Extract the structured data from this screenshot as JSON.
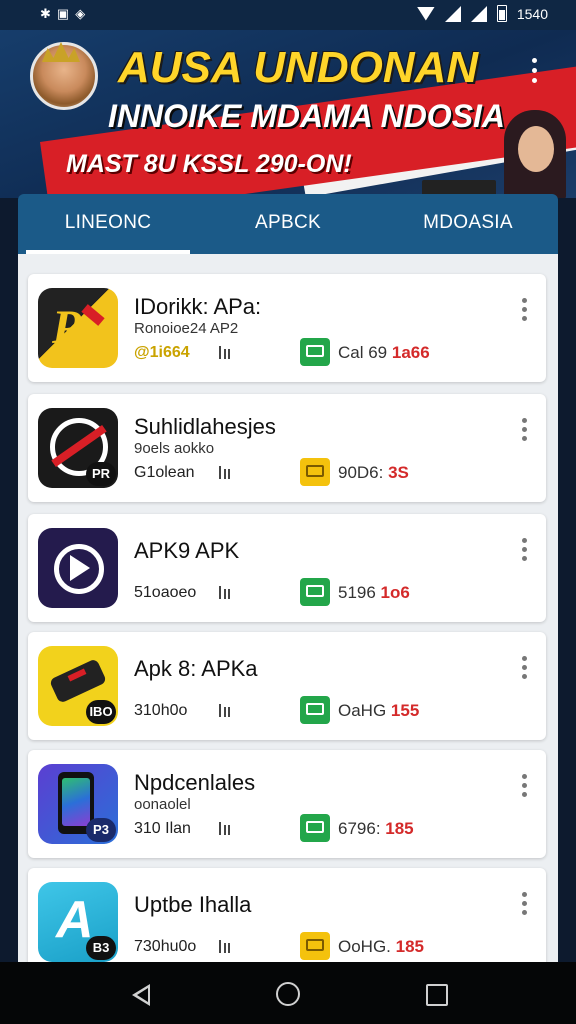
{
  "status_bar": {
    "time": "1540",
    "left_icons": [
      "notification-icon",
      "photo-icon",
      "shield-icon"
    ]
  },
  "banner": {
    "title": "AUSA UNDONAN",
    "subtitle": "INNOIKE MDAMA NDOSIA",
    "promo": "MAST 8U KSSL 290-ON!"
  },
  "tabs": [
    {
      "label": "LINEONC",
      "active": true
    },
    {
      "label": "APBCK",
      "active": false
    },
    {
      "label": "MDOASIA",
      "active": false
    }
  ],
  "apps": [
    {
      "name": "IDorikk: APa:",
      "developer": "Ronoioe24 AP2",
      "meta": "@1i664",
      "meta_highlight": true,
      "store_color": "green",
      "size_text": "Cal 69",
      "size_red": "1a66",
      "icon": "pen-icon",
      "badge": ""
    },
    {
      "name": "Suhlidlahesjes",
      "developer": "9oels aokko",
      "meta": "G1olean",
      "meta_highlight": false,
      "store_color": "yellow",
      "size_text": "90D6: ",
      "size_red": "3S",
      "icon": "no-access-icon",
      "badge": "PR"
    },
    {
      "name": "APK9 APK",
      "developer": "",
      "meta": "51oaoeo",
      "meta_highlight": false,
      "store_color": "green",
      "size_text": "5196 ",
      "size_red": "1o6",
      "icon": "play-icon",
      "badge": ""
    },
    {
      "name": "Apk 8: APKa",
      "developer": "",
      "meta": "310h0o",
      "meta_highlight": false,
      "store_color": "green",
      "size_text": "OaHG ",
      "size_red": "155",
      "icon": "phone-device-icon",
      "badge": "IBO"
    },
    {
      "name": "Npdcenlales",
      "developer": "oonaolel",
      "meta": "310 Ilan",
      "meta_highlight": false,
      "store_color": "green",
      "size_text": "6796: ",
      "size_red": "185",
      "icon": "smartphone-icon",
      "badge": "P3"
    },
    {
      "name": "Uptbe Ihalla",
      "developer": "",
      "meta": "730hu0o",
      "meta_highlight": false,
      "store_color": "yellow",
      "size_text": "OoHG. ",
      "size_red": "185",
      "icon": "app-store-icon",
      "badge": "B3"
    }
  ],
  "colors": {
    "tab_bar": "#1b5a88",
    "banner_bg": "#0f2b52",
    "accent_red": "#d42a2a",
    "store_green": "#23a64a",
    "store_yellow": "#f4c20d"
  }
}
